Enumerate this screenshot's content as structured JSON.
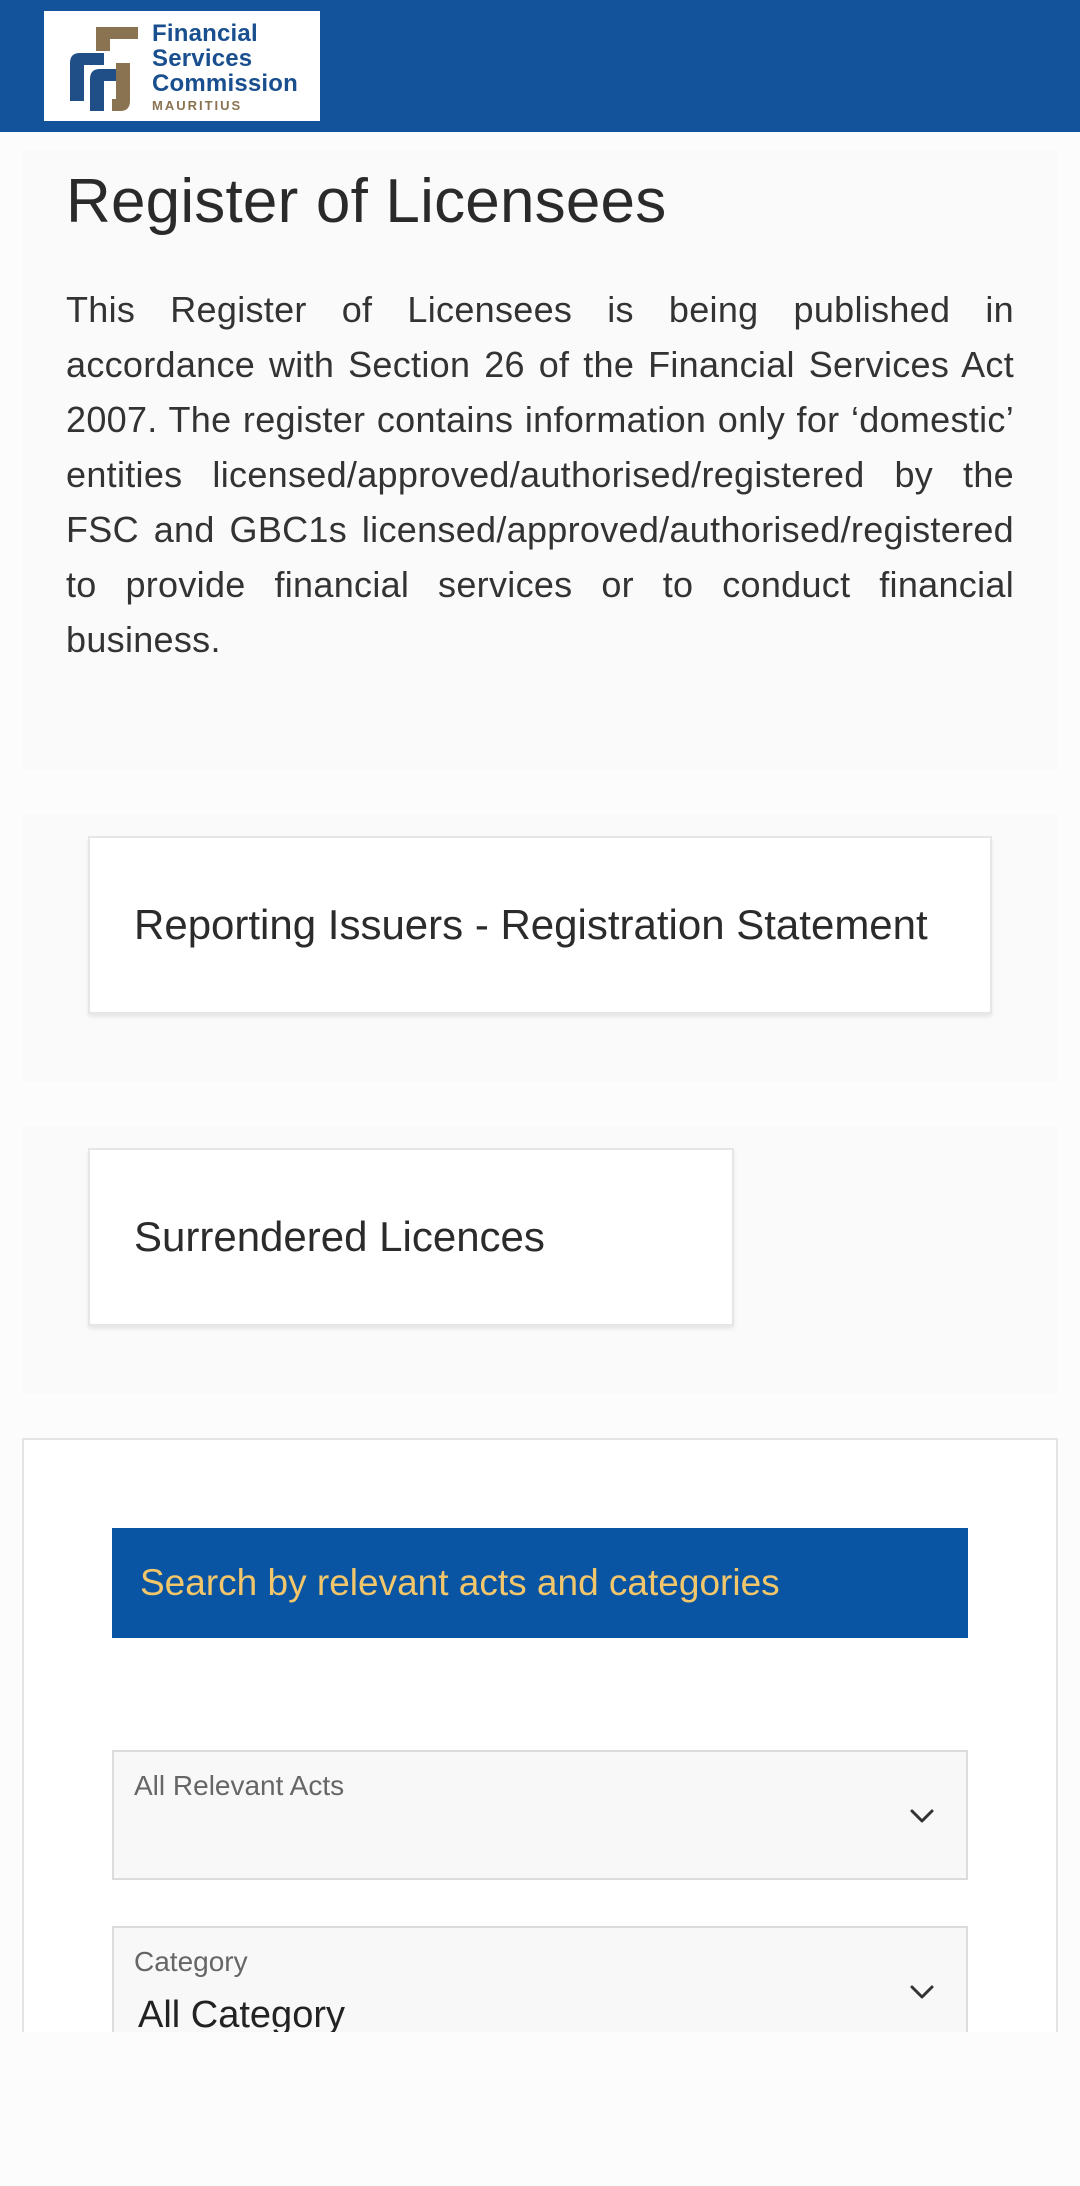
{
  "header": {
    "logo": {
      "line1": "Financial",
      "line2": "Services",
      "line3": "Commission",
      "sub": "MAURITIUS"
    },
    "brand_color": "#12539c"
  },
  "intro": {
    "title": "Register of Licensees",
    "text": "This Register of Licensees is being published in accordance with Section 26 of the Financial Services Act 2007. The register contains information only for ‘domestic’ entities licensed/approved/authorised/registered by the FSC and GBC1s licensed/approved/authorised/registered to provide financial services or to conduct financial business."
  },
  "tiles": [
    {
      "label": "Reporting Issuers - Registration Statement"
    },
    {
      "label": "Surrendered Licences"
    }
  ],
  "search": {
    "banner": "Search by relevant acts and categories",
    "banner_color": "#0a55a3",
    "banner_text_color": "#f2c66a",
    "acts_select": {
      "label": "All Relevant Acts",
      "value": ""
    },
    "category_select": {
      "label": "Category",
      "value": "All Category"
    },
    "chevron_icon": "chevron-down-icon"
  }
}
